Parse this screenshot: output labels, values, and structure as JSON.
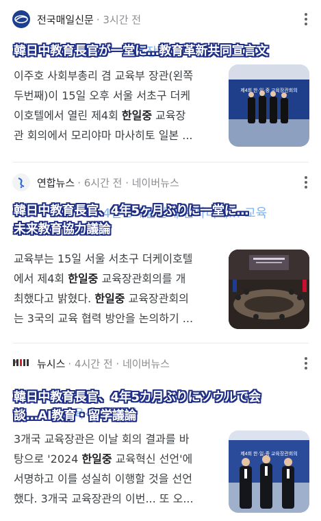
{
  "articles": [
    {
      "source": "전국매일신문",
      "meta": "· 3시간 전",
      "headline": "韓日中教育長官が一堂に…教育革新共同宣言文",
      "ghost_text": "교육장",
      "snippet_lines": [
        "이주호 사회부총리 겸 교육부 장관(왼쪽",
        "두번째)이 15일 오후 서울 서초구 더케",
        "이호텔에서 열린 제4회 ",
        "한일중",
        " 교육장",
        "관 회의에서 모리야마 마사히토 일본 ..."
      ]
    },
    {
      "source": "연합뉴스",
      "meta": "· 6시간 전 · 네이버뉴스",
      "headline": "韓日中教育長官、4年5ヶ月ぶりに一堂に…\n未来教育協力議論",
      "ghost_text": "4년 5개월만에 한자리에… 교육",
      "snippet_lines": [
        "교육부는 15일 서울 서초구 더케이호텔",
        "에서 제4회 ",
        "한일중",
        " 교육장관회의를 개",
        "최했다고 밝혔다. ",
        "한일중",
        " 교육장관회의",
        "는 3국의 교육 협력 방안을 논의하기 ..."
      ]
    },
    {
      "source": "뉴시스",
      "meta": "· 4시간 전 · 네이버뉴스",
      "headline": "韓日中教育長官、4年5カ月ぶりにソウルで会\n談…AI教育・留学議論",
      "ghost_text": "교육·유학 논의",
      "snippet_lines": [
        "3개국 교육장관은 이날 회의 결과를 바",
        "탕으로 '2024 ",
        "한일중",
        " 교육혁신 선언'에",
        "서명하고 이를 성실히 이행할 것을 선언",
        "했다. 3개국 교육장관의 이번... 또 오..."
      ]
    }
  ],
  "thumb_texts": {
    "t1": "제4회 한·일·중 교육장관회의",
    "t3": "제4회 한·일·중 교육장관회의"
  },
  "colors": {
    "headline_outline": "#1f2f86",
    "source_meta": "#8a8d91",
    "divider": "#e8eaed"
  }
}
